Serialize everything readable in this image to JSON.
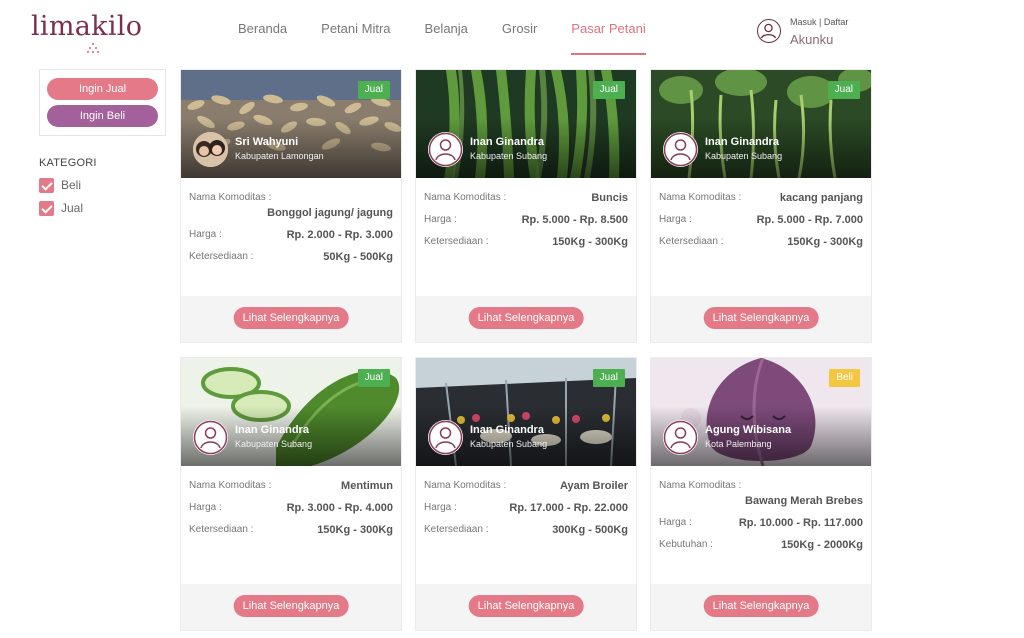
{
  "brand": {
    "name": "limakilo"
  },
  "nav": [
    {
      "label": "Beranda",
      "active": false
    },
    {
      "label": "Petani Mitra",
      "active": false
    },
    {
      "label": "Belanja",
      "active": false
    },
    {
      "label": "Grosir",
      "active": false
    },
    {
      "label": "Pasar Petani",
      "active": true
    }
  ],
  "account": {
    "login_register": "Masuk | Daftar",
    "label": "Akunku",
    "icon": "user-icon"
  },
  "sidebar": {
    "sell_button": "Ingin Jual",
    "buy_button": "Ingin Beli",
    "category_title": "KATEGORI",
    "categories": [
      {
        "label": "Beli",
        "checked": true
      },
      {
        "label": "Jual",
        "checked": true
      }
    ]
  },
  "labels": {
    "commodity": "Nama Komoditas :",
    "price": "Harga :",
    "availability": "Ketersediaan :",
    "need": "Kebutuhan :",
    "more": "Lihat Selengkapnya"
  },
  "colors": {
    "accent": "#e47a88",
    "secondary": "#a4609a",
    "brand": "#7a2f4e",
    "sell_badge": "#4caf50",
    "buy_badge": "#f4c741"
  },
  "listings": [
    {
      "type": "Jual",
      "owner": "Sri Wahyuni",
      "location": "Kabupaten Lamongan",
      "commodity": "Bonggol jagung/ jagung",
      "price": "Rp. 2.000 - Rp. 3.000",
      "qty_label": "Ketersediaan :",
      "qty": "50Kg - 500Kg",
      "image": "corn-cobs"
    },
    {
      "type": "Jual",
      "owner": "Inan Ginandra",
      "location": "Kabupaten Subang",
      "commodity": "Buncis",
      "price": "Rp. 5.000 - Rp. 8.500",
      "qty_label": "Ketersediaan :",
      "qty": "150Kg - 300Kg",
      "image": "green-beans"
    },
    {
      "type": "Jual",
      "owner": "Inan Ginandra",
      "location": "Kabupaten Subang",
      "commodity": "kacang panjang",
      "price": "Rp. 5.000 - Rp. 7.000",
      "qty_label": "Ketersediaan :",
      "qty": "150Kg - 300Kg",
      "image": "long-beans"
    },
    {
      "type": "Jual",
      "owner": "Inan Ginandra",
      "location": "Kabupaten Subang",
      "commodity": "Mentimun",
      "price": "Rp. 3.000 - Rp. 4.000",
      "qty_label": "Ketersediaan :",
      "qty": "150Kg - 300Kg",
      "image": "cucumber"
    },
    {
      "type": "Jual",
      "owner": "Inan Ginandra",
      "location": "Kabupaten Subang",
      "commodity": "Ayam Broiler",
      "price": "Rp. 17.000 - Rp. 22.000",
      "qty_label": "Ketersediaan :",
      "qty": "300Kg - 500Kg",
      "image": "broiler-farm"
    },
    {
      "type": "Beli",
      "owner": "Agung Wibisana",
      "location": "Kota Palembang",
      "commodity": "Bawang Merah Brebes",
      "price": "Rp. 10.000 - Rp. 117.000",
      "qty_label": "Kebutuhan :",
      "qty": "150Kg - 2000Kg",
      "image": "shallot-cartoon"
    }
  ]
}
